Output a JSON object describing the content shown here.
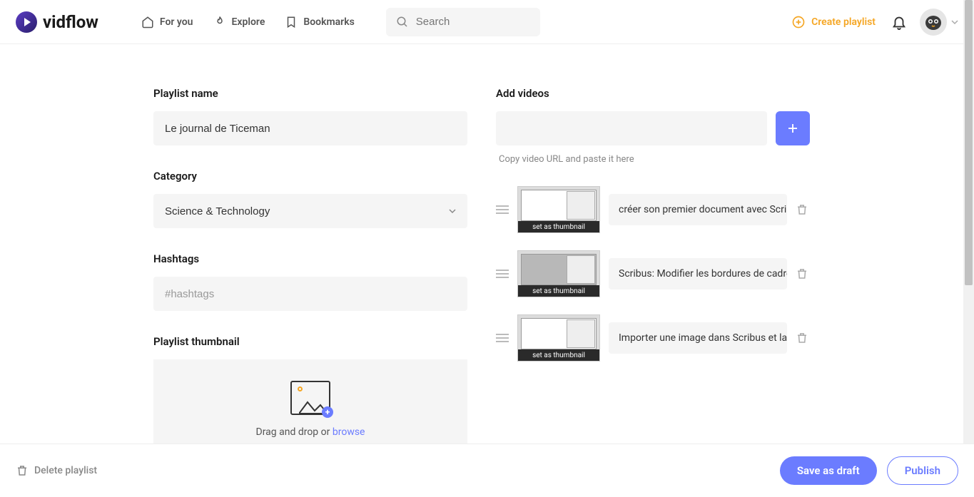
{
  "header": {
    "brand": "vidflow",
    "nav": {
      "for_you": "For you",
      "explore": "Explore",
      "bookmarks": "Bookmarks"
    },
    "search_placeholder": "Search",
    "create_label": "Create playlist"
  },
  "form": {
    "name_label": "Playlist name",
    "name_value": "Le journal de Ticeman",
    "category_label": "Category",
    "category_value": "Science & Technology",
    "hashtags_label": "Hashtags",
    "hashtags_placeholder": "#hashtags",
    "thumbnail_label": "Playlist thumbnail",
    "upload_text_prefix": "Drag and drop or ",
    "upload_text_link": "browse"
  },
  "videos": {
    "add_label": "Add videos",
    "helper": "Copy video URL and paste it here",
    "set_thumb": "set as thumbnail",
    "items": [
      {
        "title": "créer son premier document avec Scribus"
      },
      {
        "title": "Scribus: Modifier les bordures de cadres"
      },
      {
        "title": "Importer une image dans Scribus et la mo"
      }
    ]
  },
  "footer": {
    "delete": "Delete playlist",
    "save": "Save as draft",
    "publish": "Publish"
  }
}
